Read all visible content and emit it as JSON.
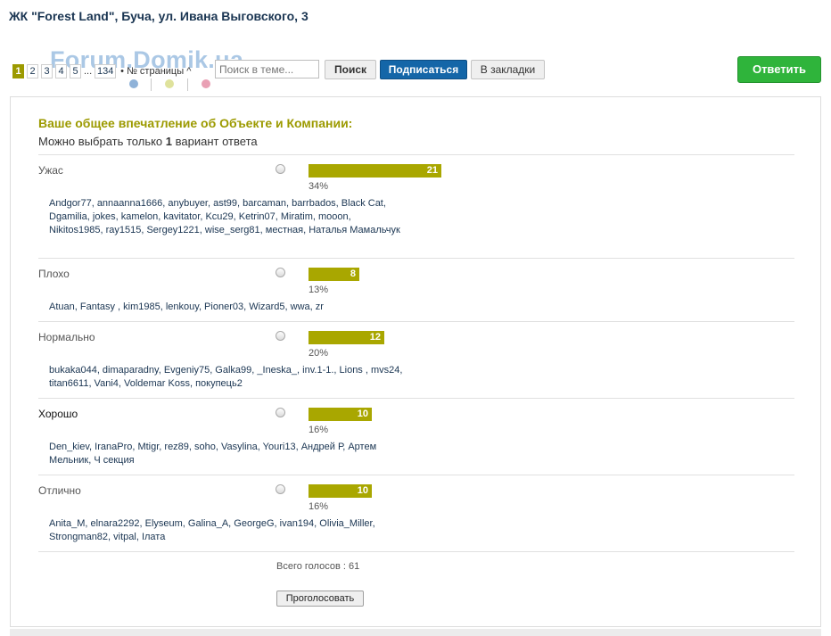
{
  "topic": {
    "title": "ЖК \"Forest Land\", Буча, ул. Ивана Выговского, 3"
  },
  "watermark": "Forum.Domik.ua",
  "pagination": {
    "pages": [
      "1",
      "2",
      "3",
      "4",
      "5"
    ],
    "ellipsis": "...",
    "last": "134",
    "label": "• № страницы ^"
  },
  "toolbar": {
    "search_placeholder": "Поиск в теме...",
    "search_label": "Поиск",
    "subscribe_label": "Подписаться",
    "bookmark_label": "В закладки",
    "reply_label": "Ответить"
  },
  "poll": {
    "question": "Ваше общее впечатление об Объекте и Компании:",
    "hint_prefix": "Можно выбрать только",
    "hint_count": "1",
    "hint_suffix": "вариант ответа",
    "options": [
      {
        "label": "Ужас",
        "votes": 21,
        "votes_text": "21",
        "percent": 34,
        "percent_text": "34%",
        "voters": "Andgor77, annaanna1666, anybuyer, ast99, barcaman, barrbados, Black Cat, Dgamilia, jokes, kamelon, kavitator, Kcu29, Ketrin07, Miratim, mooon, Nikitos1985, ray1515, Sergey1221, wise_serg81, местная, Наталья Мамальчук"
      },
      {
        "label": "Плохо",
        "votes": 8,
        "votes_text": "8",
        "percent": 13,
        "percent_text": "13%",
        "voters": "Atuan, Fantasy , kim1985, lenkouy, Pioner03, Wizard5, wwa, zr"
      },
      {
        "label": "Нормально",
        "votes": 12,
        "votes_text": "12",
        "percent": 20,
        "percent_text": "20%",
        "voters": "bukaka044, dimaparadny, Evgeniy75, Galka99, _Ineska_, inv.1-1., Lions , mvs24, titan6611, Vani4, Voldemar Koss, покупець2"
      },
      {
        "label": "Хорошо",
        "votes": 10,
        "votes_text": "10",
        "percent": 16,
        "percent_text": "16%",
        "voters": "Den_kiev, IranaPro, Mtigr, rez89, soho, Vasylina, Youri13, Андрей Р, Артем Мельник, Ч секция"
      },
      {
        "label": "Отлично",
        "votes": 10,
        "votes_text": "10",
        "percent": 16,
        "percent_text": "16%",
        "voters": "Anita_M, elnara2292, Elyseum, Galina_A, GeorgeG, ivan194, Olivia_Miller, Strongman82, vitpal, Ілата"
      }
    ],
    "total": "Всего голосов : 61",
    "vote_button": "Проголосовать"
  },
  "colors": {
    "accent": "#9c9a00",
    "bar": "#a9a700",
    "subscribe": "#1466a8",
    "reply": "#2fb43b",
    "title": "#1a3552"
  }
}
